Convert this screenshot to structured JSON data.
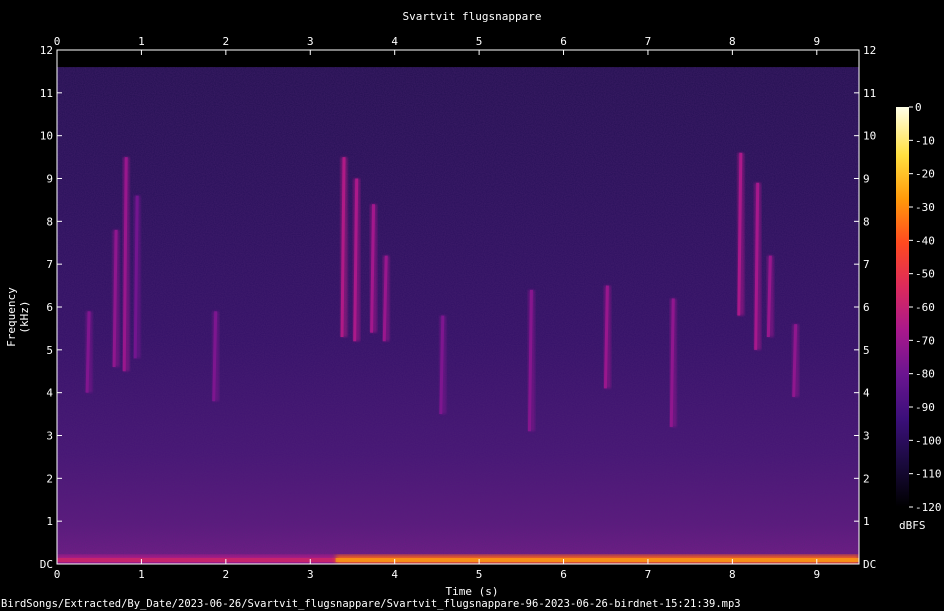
{
  "chart_data": {
    "type": "heatmap",
    "title": "Svartvit flugsnappare",
    "xlabel": "Time (s)",
    "ylabel": "Frequency (kHz)",
    "xlim": [
      0,
      9.5
    ],
    "ylim": [
      0,
      12
    ],
    "x_ticks": [
      "0",
      "1",
      "2",
      "3",
      "4",
      "5",
      "6",
      "7",
      "8",
      "9"
    ],
    "y_ticks": [
      "DC",
      "1",
      "2",
      "3",
      "4",
      "5",
      "6",
      "7",
      "8",
      "9",
      "10",
      "11",
      "12"
    ],
    "colorbar": {
      "label": "dBFS",
      "range": [
        -120,
        0
      ],
      "ticks": [
        "0",
        "-10",
        "-20",
        "-30",
        "-40",
        "-50",
        "-60",
        "-70",
        "-80",
        "-90",
        "-100",
        "-110",
        "-120"
      ],
      "colors": [
        "#000000",
        "#1a0a3e",
        "#3b0f7a",
        "#6a1590",
        "#a8188c",
        "#dc2a5c",
        "#ff4a20",
        "#ff9a0a",
        "#ffe040",
        "#ffffe8"
      ]
    },
    "signal_cutoff_khz": 11.6,
    "calls": [
      {
        "t": 0.38,
        "f_low": 4.0,
        "f_high": 5.9,
        "level_dbfs": -75
      },
      {
        "t": 0.7,
        "f_low": 4.6,
        "f_high": 7.8,
        "level_dbfs": -72
      },
      {
        "t": 0.82,
        "f_low": 4.5,
        "f_high": 9.5,
        "level_dbfs": -70
      },
      {
        "t": 0.95,
        "f_low": 4.8,
        "f_high": 8.6,
        "level_dbfs": -78
      },
      {
        "t": 1.88,
        "f_low": 3.8,
        "f_high": 5.9,
        "level_dbfs": -76
      },
      {
        "t": 3.4,
        "f_low": 5.3,
        "f_high": 9.5,
        "level_dbfs": -65
      },
      {
        "t": 3.55,
        "f_low": 5.2,
        "f_high": 9.0,
        "level_dbfs": -66
      },
      {
        "t": 3.75,
        "f_low": 5.4,
        "f_high": 8.4,
        "level_dbfs": -68
      },
      {
        "t": 3.9,
        "f_low": 5.2,
        "f_high": 7.2,
        "level_dbfs": -70
      },
      {
        "t": 4.57,
        "f_low": 3.5,
        "f_high": 5.8,
        "level_dbfs": -76
      },
      {
        "t": 5.62,
        "f_low": 3.1,
        "f_high": 6.4,
        "level_dbfs": -74
      },
      {
        "t": 6.52,
        "f_low": 4.1,
        "f_high": 6.5,
        "level_dbfs": -70
      },
      {
        "t": 7.3,
        "f_low": 3.2,
        "f_high": 6.2,
        "level_dbfs": -72
      },
      {
        "t": 8.1,
        "f_low": 5.8,
        "f_high": 9.6,
        "level_dbfs": -66
      },
      {
        "t": 8.3,
        "f_low": 5.0,
        "f_high": 8.9,
        "level_dbfs": -67
      },
      {
        "t": 8.45,
        "f_low": 5.3,
        "f_high": 7.2,
        "level_dbfs": -70
      },
      {
        "t": 8.75,
        "f_low": 3.9,
        "f_high": 5.6,
        "level_dbfs": -72
      }
    ],
    "low_frequency_noise": [
      {
        "t_start": 0.0,
        "t_end": 3.3,
        "level_dbfs": -65
      },
      {
        "t_start": 3.3,
        "t_end": 9.5,
        "level_dbfs": -35
      }
    ]
  },
  "footer": "BirdSongs/Extracted/By_Date/2023-06-26/Svartvit_flugsnappare/Svartvit_flugsnappare-96-2023-06-26-birdnet-15:21:39.mp3"
}
